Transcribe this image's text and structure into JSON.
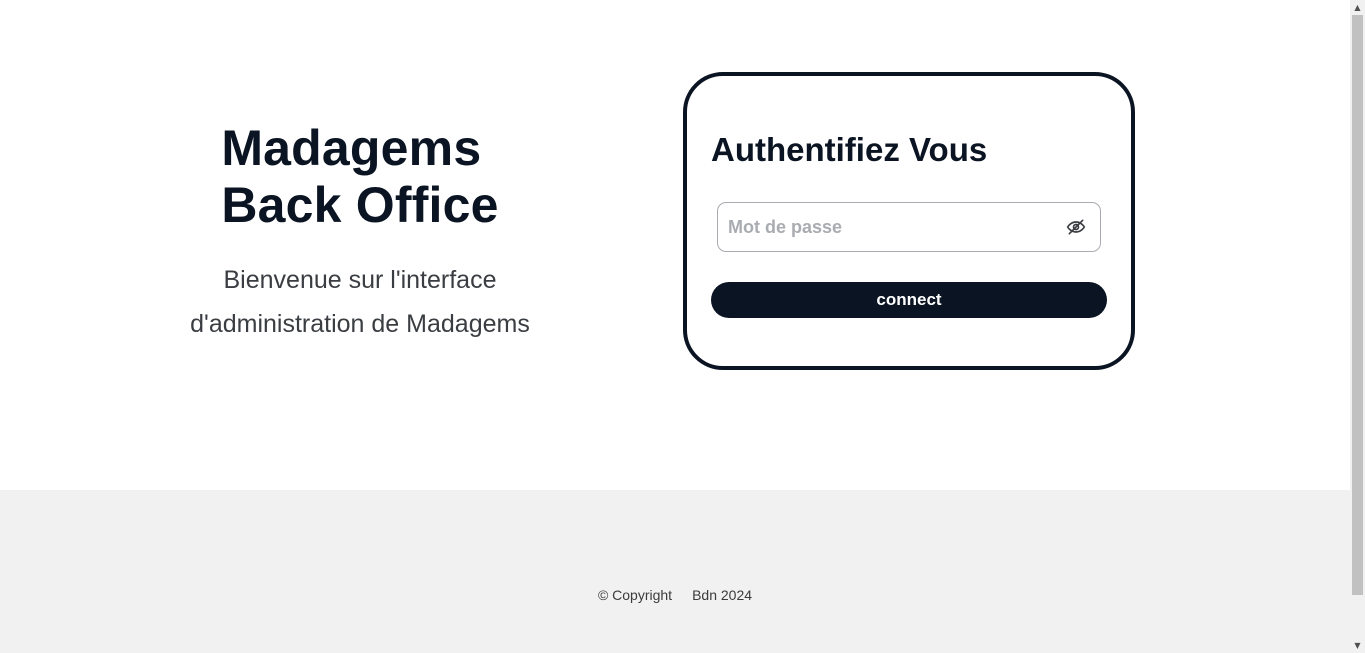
{
  "hero": {
    "title_line1": "Madagems",
    "title_line2": "Back Office",
    "subtitle_line1": "Bienvenue sur l'interface",
    "subtitle_line2": "d'administration de Madagems"
  },
  "login": {
    "title": "Authentifiez Vous",
    "password_placeholder": "Mot de passe",
    "password_value": "",
    "toggle_icon": "eye-off-icon",
    "connect_label": "connect"
  },
  "footer": {
    "copyright": "© Copyright",
    "owner": "Bdn 2024"
  },
  "colors": {
    "primary": "#0b1422",
    "footer_bg": "#f1f1f1",
    "placeholder": "#a9acb0"
  }
}
